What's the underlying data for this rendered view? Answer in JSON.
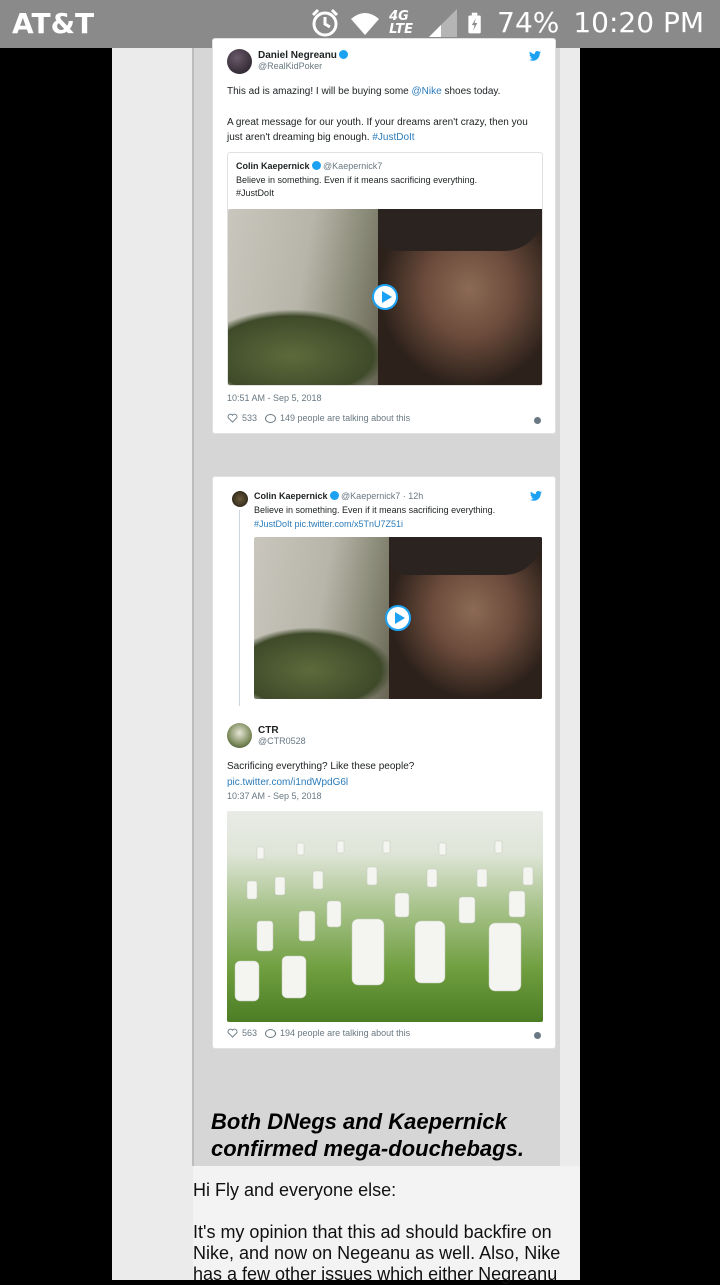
{
  "status_bar": {
    "carrier": "AT&T",
    "network": "4G LTE",
    "battery": "74%",
    "time": "10:20 PM"
  },
  "embed1": {
    "author_name": "Daniel Negreanu",
    "author_handle": "@RealKidPoker",
    "text_a": "This ad is amazing! I will be buying some ",
    "text_mention": "@Nike",
    "text_b": " shoes today.",
    "text_c": "A great message for our youth. If your dreams aren't crazy, then you just aren't dreaming big enough. ",
    "text_hashtag": "#JustDoIt",
    "quoted_name": "Colin Kaepernick",
    "quoted_handle": "@Kaepernick7",
    "quoted_text_1": "Believe in something. Even if it means sacrificing everything.",
    "quoted_text_2": "#JustDoIt",
    "timestamp": "10:51 AM - Sep 5, 2018",
    "likes": "533",
    "talking": "149 people are talking about this"
  },
  "embed2": {
    "parent_name": "Colin Kaepernick",
    "parent_handle": "@Kaepernick7 · 12h",
    "parent_text": "Believe in something. Even if it means sacrificing everything.",
    "parent_link": "#JustDoIt pic.twitter.com/x5TnU7Z51i",
    "author_name": "CTR",
    "author_handle": "@CTR0528",
    "text": "Sacrificing everything?  Like these people?",
    "link": "pic.twitter.com/i1ndWpdG6l",
    "timestamp": "10:37 AM - Sep 5, 2018",
    "likes": "563",
    "talking": "194 people are talking about this"
  },
  "quote_emphasis": "Both DNegs and Kaepernick confirmed mega-douchebags.",
  "post": {
    "greeting": "Hi Fly and everyone else:",
    "body": "It's my opinion that this ad should backfire on Nike, and now on Negeanu as well. Also, Nike has a few other issues which either Negreanu"
  },
  "colors": {
    "twitter_blue": "#1da1f2",
    "link_blue": "#2b7bb9",
    "status_bar_bg": "#8a8a8a"
  }
}
